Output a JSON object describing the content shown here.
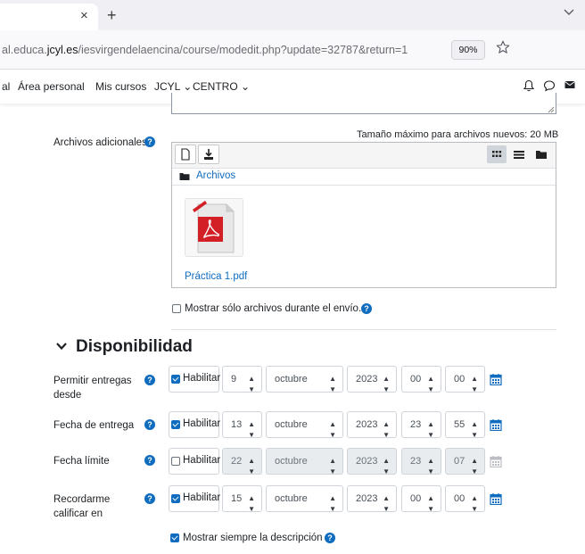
{
  "browser": {
    "tab_close": "×",
    "new_tab": "+",
    "url_prefix": "al.educa.",
    "url_domain": "jcyl.es",
    "url_path": "/iesvirgendelaencina/course/modedit.php?update=32787&return=1",
    "zoom": "90%"
  },
  "nav": {
    "items": [
      {
        "label": "al"
      },
      {
        "label": "Área personal"
      },
      {
        "label": "Mis cursos"
      },
      {
        "label": "JCYL ⌄"
      },
      {
        "label": "CENTRO ⌄"
      }
    ]
  },
  "files": {
    "label": "Archivos adicionales",
    "max_size": "Tamaño máximo para archivos nuevos: 20 MB",
    "path_label": "Archivos",
    "file_name": "Práctica 1.pdf",
    "show_only_label": "Mostrar sólo archivos durante el envío."
  },
  "availability": {
    "title": "Disponibilidad",
    "enable_label": "Habilitar",
    "rows": [
      {
        "label": "Permitir entregas desde",
        "enabled": true,
        "day": "9",
        "month": "octubre",
        "year": "2023",
        "hour": "00",
        "minute": "00"
      },
      {
        "label": "Fecha de entrega",
        "enabled": true,
        "day": "13",
        "month": "octubre",
        "year": "2023",
        "hour": "23",
        "minute": "55"
      },
      {
        "label": "Fecha límite",
        "enabled": false,
        "day": "22",
        "month": "octubre",
        "year": "2023",
        "hour": "23",
        "minute": "07"
      },
      {
        "label": "Recordarme calificar en",
        "enabled": true,
        "day": "15",
        "month": "octubre",
        "year": "2023",
        "hour": "00",
        "minute": "00"
      }
    ],
    "always_show_description": "Mostrar siempre la descripción"
  },
  "colors": {
    "accent": "#0f6cbf",
    "help_icon": "#0f6cbf",
    "pdf_red": "#d31f26"
  }
}
